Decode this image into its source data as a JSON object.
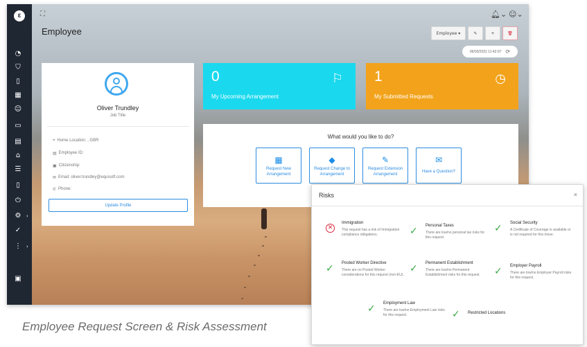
{
  "page": {
    "title": "Employee"
  },
  "toolbar": {
    "dropdown_label": "Employee ▾",
    "edit_icon": "pencil-icon",
    "add_icon": "plus-icon",
    "delete_icon": "trash-icon"
  },
  "timestamp": "06/03/2021 11:42:07",
  "profile": {
    "name": "Oliver Trundley",
    "job_title": "Job Title",
    "rows": [
      {
        "icon": "map-pin-icon",
        "glyph": "⌖",
        "text": "Home Location: , GBR"
      },
      {
        "icon": "id-card-icon",
        "glyph": "▤",
        "text": "Employee ID:"
      },
      {
        "icon": "passport-icon",
        "glyph": "▣",
        "text": "Citizenship:"
      },
      {
        "icon": "envelope-icon",
        "glyph": "✉",
        "text": "Email: oliver.trundley@equisoft.com"
      },
      {
        "icon": "phone-icon",
        "glyph": "✆",
        "text": "Phone:"
      }
    ],
    "update_label": "Update Profile"
  },
  "tiles": {
    "upcoming": {
      "count": "0",
      "label": "My Upcoming Arrangement",
      "icon": "flag-icon"
    },
    "submitted": {
      "count": "1",
      "label": "My Submitted Requests",
      "icon": "clock-icon"
    }
  },
  "actions": {
    "title": "What would you like to do?",
    "items": [
      {
        "label": "Request New Arrangement",
        "icon": "calendar-icon",
        "glyph": "▦"
      },
      {
        "label": "Request Change to Arrangement",
        "icon": "eraser-icon",
        "glyph": "◆"
      },
      {
        "label": "Request Extension Arrangement",
        "icon": "edit-icon",
        "glyph": "✎"
      },
      {
        "label": "Have a Question?",
        "icon": "envelope-icon",
        "glyph": "✉"
      }
    ]
  },
  "risks": {
    "title": "Risks",
    "close": "×",
    "items": [
      {
        "name": "Immigration",
        "status": "risk",
        "desc": "This request has a risk of Immigration compliance obligations."
      },
      {
        "name": "Personal Taxes",
        "status": "ok",
        "desc": "There are low/no personal tax risks for this request."
      },
      {
        "name": "Social Security",
        "status": "ok",
        "desc": "A Certificate of Coverage is available or is not required for this move."
      },
      {
        "name": "Posted Worker Directive",
        "status": "ok",
        "desc": "There are no Posted Worker considerations for this request (non-EU)."
      },
      {
        "name": "Permanent Establishment",
        "status": "ok",
        "desc": "There are low/no Permanent Establishment risks for this request."
      },
      {
        "name": "Employer Payroll",
        "status": "ok",
        "desc": "There are low/no Employer Payroll risks for this request."
      },
      {
        "name": "Employment Law",
        "status": "ok",
        "desc": "There are low/no Employment Law risks for this request."
      },
      {
        "name": "Restricted Locations",
        "status": "ok",
        "desc": ""
      }
    ]
  },
  "caption": "Employee Request Screen & Risk Assessment",
  "colors": {
    "accent_blue": "#2a8be0",
    "cyan_tile": "#1ad9ee",
    "orange_tile": "#f2a31b",
    "check_green": "#39a845",
    "risk_red": "#d9263a",
    "sidebar": "#1f2733"
  }
}
